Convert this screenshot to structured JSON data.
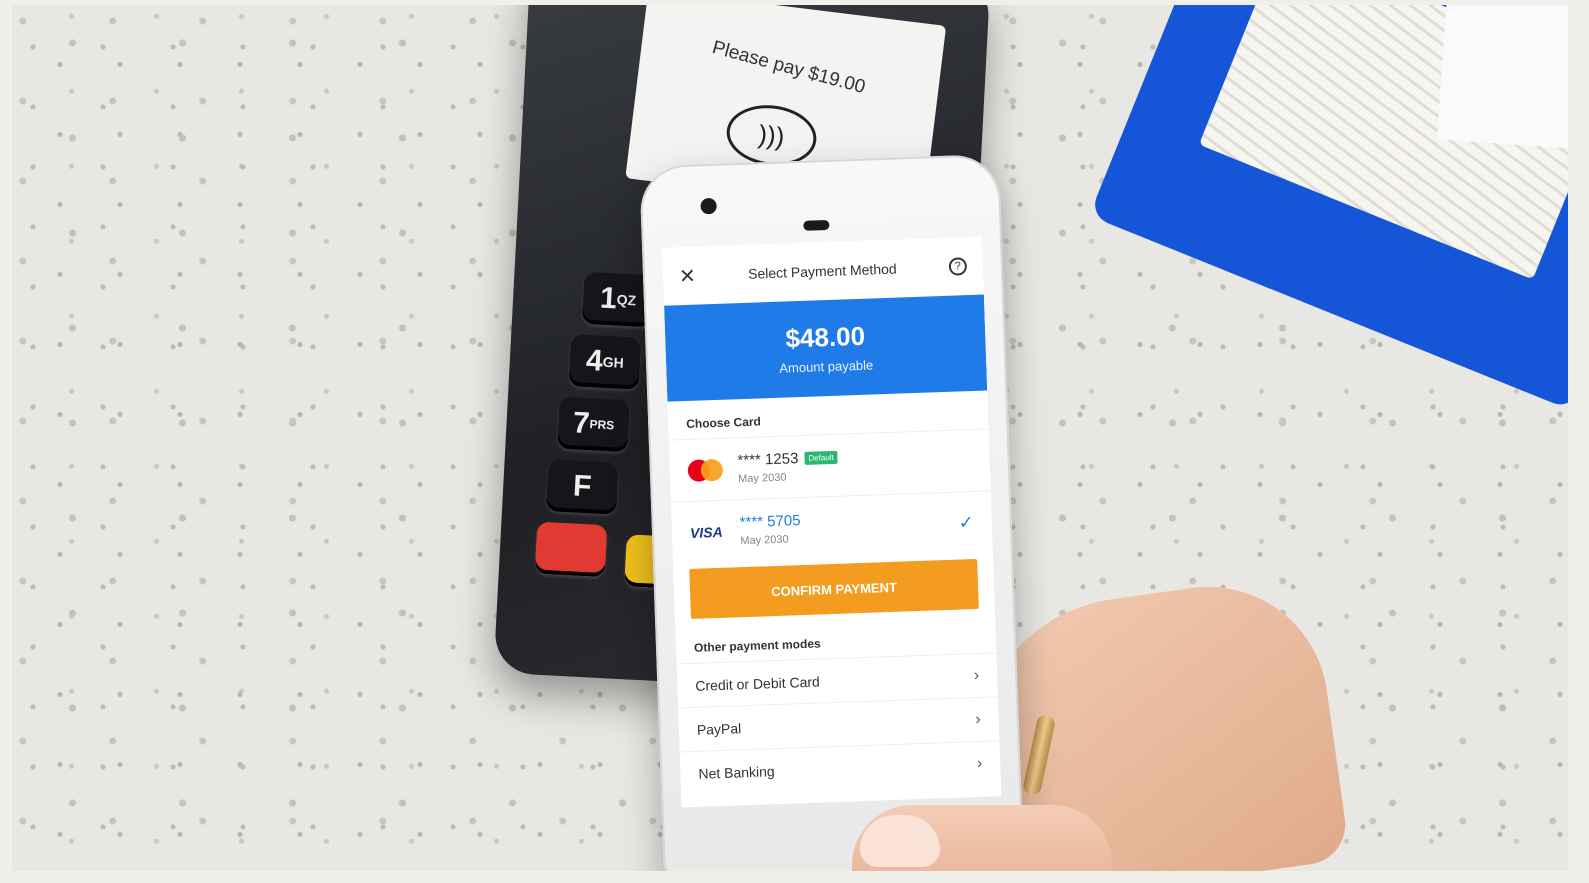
{
  "terminal": {
    "screen_message": "Please pay $19.00",
    "keys": [
      {
        "label": "1",
        "sub": "QZ"
      },
      {
        "label": "4",
        "sub": "GH"
      },
      {
        "label": "7",
        "sub": "PRS"
      },
      {
        "label": "F",
        "sub": ""
      }
    ]
  },
  "app": {
    "title": "Select Payment Method",
    "close_icon": "close-icon",
    "help_icon": "help-icon",
    "amount": "$48.00",
    "amount_label": "Amount payable",
    "choose_card_label": "Choose Card",
    "cards": [
      {
        "brand": "mastercard",
        "number": "**** 1253",
        "badge": "Default",
        "expiry": "May 2030",
        "selected": false
      },
      {
        "brand": "VISA",
        "number": "**** 5705",
        "badge": "",
        "expiry": "May 2030",
        "selected": true
      }
    ],
    "confirm_label": "CONFIRM PAYMENT",
    "other_modes_label": "Other payment modes",
    "other_modes": [
      {
        "label": "Credit or Debit Card"
      },
      {
        "label": "PayPal"
      },
      {
        "label": "Net Banking"
      }
    ]
  },
  "colors": {
    "primary_blue": "#1f7be8",
    "confirm_orange": "#f39c1f",
    "default_badge_green": "#2bb673"
  }
}
